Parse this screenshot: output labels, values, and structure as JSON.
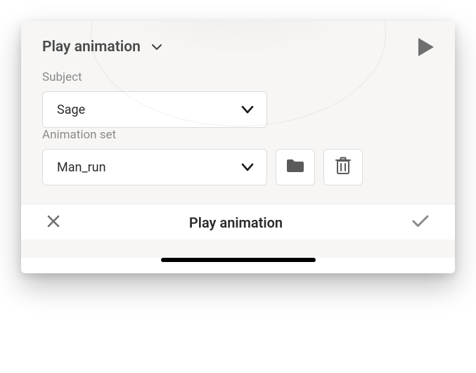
{
  "header": {
    "title": "Play animation"
  },
  "subject": {
    "label": "Subject",
    "value": "Sage"
  },
  "animation_set": {
    "label": "Animation set",
    "value": "Man_run"
  },
  "footer": {
    "title": "Play animation"
  },
  "icons": {
    "chevron_down": "chevron-down-icon",
    "play": "play-icon",
    "folder": "folder-icon",
    "trash": "trash-icon",
    "close": "close-icon",
    "check": "check-icon"
  },
  "colors": {
    "panel_bg": "#f7f6f5",
    "text_primary": "#2b2b2b",
    "text_muted": "#8b8b8b",
    "border": "#dedcdb",
    "icon_gray": "#6f6f6f"
  }
}
